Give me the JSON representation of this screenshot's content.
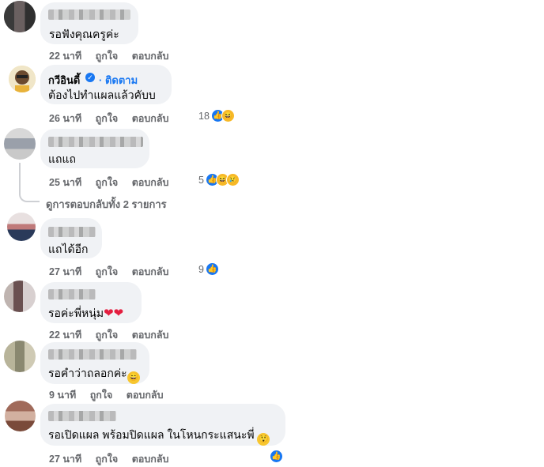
{
  "actions": {
    "like": "ถูกใจ",
    "reply": "ตอบกลับ"
  },
  "comments": [
    {
      "author": "",
      "text": "รอฟังคุณครูค่ะ",
      "time": "22 นาที",
      "reactions": ""
    },
    {
      "author": "กวีอินดี้",
      "follow": "ติดตาม",
      "text": "ต้องไปทำแผลแล้วคับบ",
      "time": "26 นาที",
      "reactions": "18",
      "reaction_icons": [
        "like-icon",
        "haha-icon"
      ]
    },
    {
      "author": "",
      "text": "แถแถ",
      "time": "25 นาที",
      "reactions": "5",
      "reaction_icons": [
        "like-icon",
        "haha-icon",
        "sad-icon"
      ]
    },
    {
      "author": "",
      "text": "แถได้อีก",
      "time": "27 นาที",
      "reactions": "9",
      "reaction_icons": [
        "like-icon"
      ]
    },
    {
      "author": "",
      "text": "รอค่ะพี่หนุ่ม",
      "time": "22 นาที",
      "reactions": ""
    },
    {
      "author": "",
      "text": "รอคำว่าถลอกค่ะ",
      "time": "9 นาที",
      "reactions": ""
    },
    {
      "author": "",
      "text": "รอเปิดแผล พร้อมปิดแผล ในโหนกระแสนะพี่",
      "time": "27 นาที",
      "reactions": "",
      "reaction_icons": [
        "like-icon"
      ]
    }
  ],
  "view_replies": "ดูการตอบกลับทั้ง 2 รายการ",
  "colors": {
    "bubble": "#f0f2f5",
    "meta": "#65676b",
    "link": "#1877f2",
    "like": "#1877f2"
  }
}
